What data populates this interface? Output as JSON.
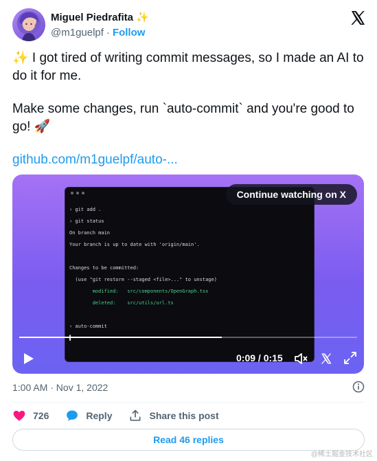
{
  "author": {
    "display_name": "Miguel Piedrafita",
    "name_emoji": "✨",
    "handle": "@m1guelpf",
    "separator": "·",
    "follow_label": "Follow"
  },
  "tweet": {
    "line1": "✨ I got tired of writing commit messages, so I made an AI to do it for me.",
    "line2": "Make some changes, run `auto-commit` and you're good to go! 🚀",
    "link": "github.com/m1guelpf/auto-..."
  },
  "video": {
    "continue_label": "Continue watching on X",
    "time_display": "0:09 / 0:15",
    "progress_fraction": 0.6,
    "terminal_lines": [
      {
        "text": "› git add .",
        "style": "normal"
      },
      {
        "text": "› git status",
        "style": "normal"
      },
      {
        "text": "On branch main",
        "style": "normal"
      },
      {
        "text": "Your branch is up to date with 'origin/main'.",
        "style": "normal"
      },
      {
        "text": "",
        "style": "normal"
      },
      {
        "text": "Changes to be committed:",
        "style": "normal"
      },
      {
        "text": "  (use \"git restore --staged <file>...\" to unstage)",
        "style": "normal"
      },
      {
        "text": "        modified:   src/components/OpenGraph.tsx",
        "style": "green"
      },
      {
        "text": "        deleted:    src/utils/url.ts",
        "style": "green"
      },
      {
        "text": "",
        "style": "normal"
      },
      {
        "text": "› auto-commit",
        "style": "normal"
      },
      {
        "text": "▌",
        "style": "normal"
      }
    ]
  },
  "meta": {
    "timestamp": "1:00 AM · Nov 1, 2022"
  },
  "actions": {
    "like_count": "726",
    "reply_label": "Reply",
    "share_label": "Share this post"
  },
  "replies_button": "Read 46 replies",
  "watermark": "@稀土掘金技术社区",
  "colors": {
    "accent": "#1d9bf0",
    "like": "#f91880",
    "text_secondary": "#536471"
  }
}
